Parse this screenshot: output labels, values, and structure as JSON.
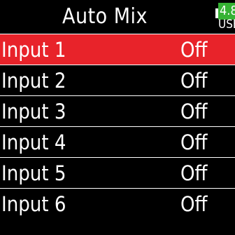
{
  "header": {
    "title": "Auto Mix",
    "battery": {
      "level_text": "4.8",
      "source_text": "USB",
      "color": "#35b233"
    }
  },
  "list": {
    "selected_index": 0,
    "selected_color": "#e8232a",
    "items": [
      {
        "label": "Input 1",
        "value": "Off"
      },
      {
        "label": "Input 2",
        "value": "Off"
      },
      {
        "label": "Input 3",
        "value": "Off"
      },
      {
        "label": "Input 4",
        "value": "Off"
      },
      {
        "label": "Input 5",
        "value": "Off"
      },
      {
        "label": "Input 6",
        "value": "Off"
      }
    ]
  }
}
